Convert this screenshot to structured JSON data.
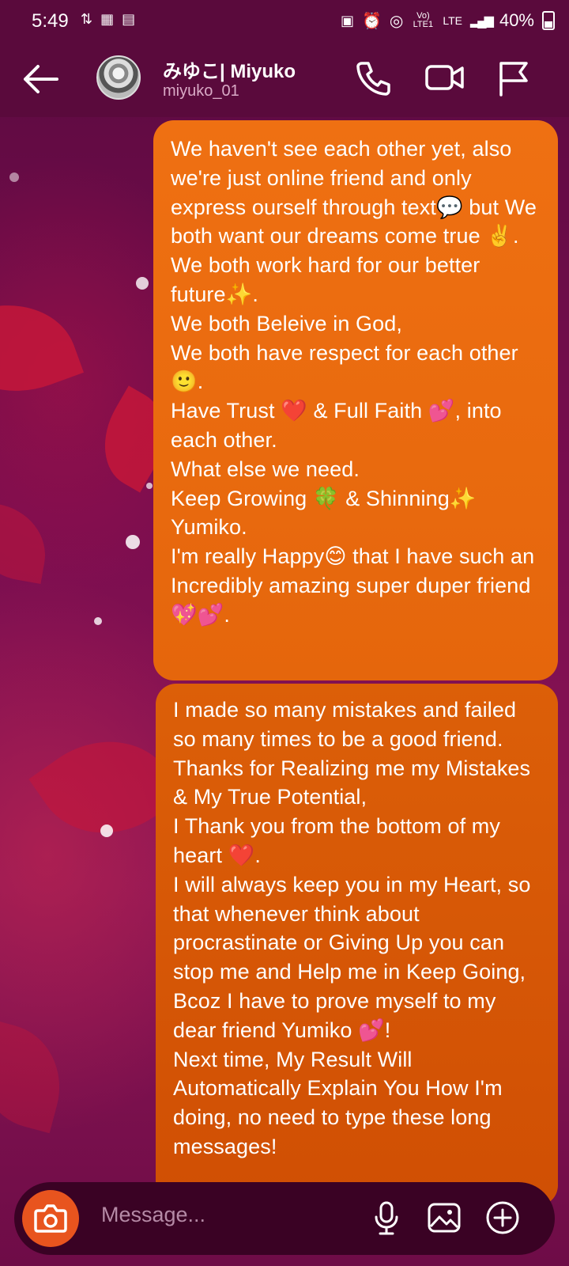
{
  "status_bar": {
    "time": "5:49",
    "signal_text": "Vo) LTE1",
    "network": "LTE",
    "battery": "40%"
  },
  "header": {
    "display_name": "みゆこ| Miyuko",
    "username": "miyuko_01",
    "icons": [
      "back-arrow-icon",
      "avatar",
      "phone-icon",
      "video-call-icon",
      "flag-icon"
    ]
  },
  "messages": [
    {
      "text": "We haven't see each other yet, also we're just online friend and only express ourself through text💬 but We both want our dreams come true ✌️.\nWe both work hard for our better future✨.\nWe both Beleive in God,\nWe both have respect for each other 🙂.\nHave Trust ❤️ & Full Faith 💕, into each other.\nWhat else we need.\nKeep Growing 🍀 & Shinning✨ Yumiko.\nI'm really Happy😊 that I have such an Incredibly amazing super duper friend 💖💕."
    },
    {
      "text": "I made so many mistakes and failed so many times to be a good friend.\nThanks for Realizing me my Mistakes & My True Potential,\nI Thank you from the bottom of my heart ❤️.\nI will always keep you in my Heart, so that whenever think about procrastinate or Giving Up you can stop me and Help me in Keep Going, Bcoz I have to prove myself to my dear friend Yumiko 💕!\nNext time, My Result Will Automatically Explain You How I'm doing, no need to type these long messages!"
    }
  ],
  "composer": {
    "placeholder": "Message...",
    "icons": [
      "camera-icon",
      "microphone-icon",
      "gallery-icon",
      "add-icon"
    ]
  },
  "colors": {
    "bubble_top": "#ef7012",
    "bubble_bottom": "#d04f04",
    "header_bg": "#5a0a3c",
    "composer_bg": "#3a0224",
    "camera_button": "#e8541e"
  }
}
